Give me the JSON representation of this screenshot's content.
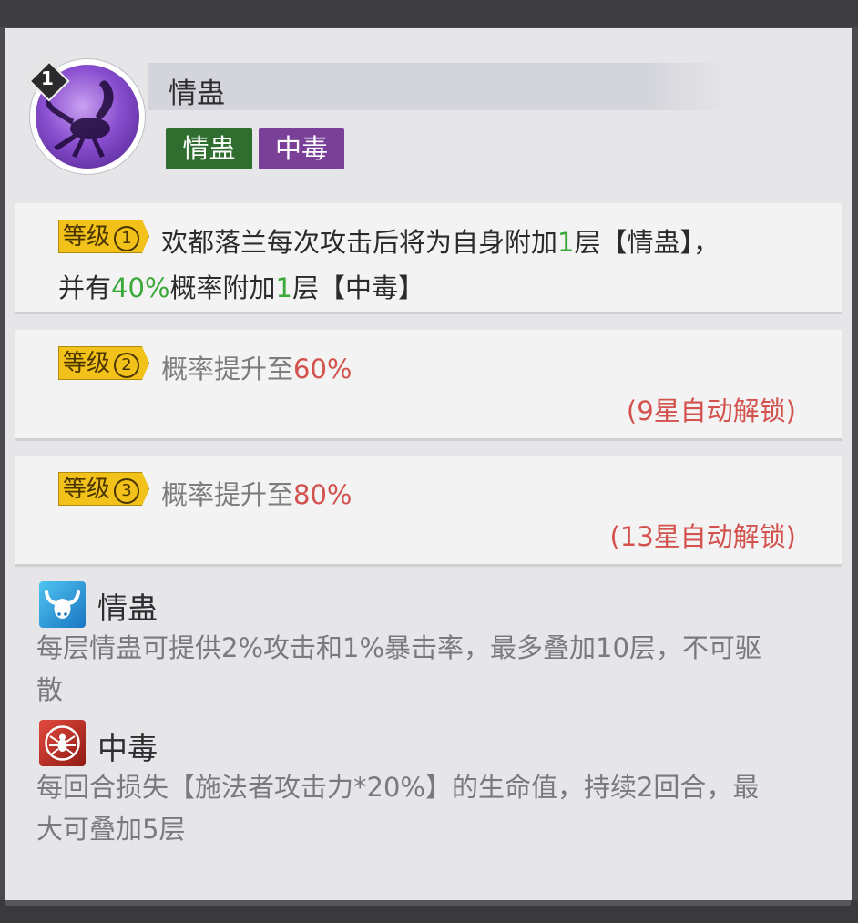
{
  "skill": {
    "level_indicator": "1",
    "name": "情蛊",
    "tags": [
      "情蛊",
      "中毒"
    ],
    "icon": "scorpion-icon"
  },
  "levels": [
    {
      "badge_text": "等级",
      "badge_num": "1",
      "line1": [
        "欢都落兰每次攻击后将为自身附加",
        "1",
        "层【情蛊】，"
      ],
      "line2": [
        "并有",
        "40%",
        "概率附加",
        "1",
        "层【中毒】"
      ]
    },
    {
      "badge_text": "等级",
      "badge_num": "2",
      "text": "概率提升至",
      "value": "60%",
      "unlock": "(9星自动解锁)"
    },
    {
      "badge_text": "等级",
      "badge_num": "3",
      "text": "概率提升至",
      "value": "80%",
      "unlock": "(13星自动解锁)"
    }
  ],
  "effects": [
    {
      "name": "情蛊",
      "icon": "bull-head-icon",
      "desc_line1": "每层情蛊可提供2%攻击和1%暴击率，最多叠加10层，不可驱",
      "desc_line2": "散"
    },
    {
      "name": "中毒",
      "icon": "spider-icon",
      "desc_line1": "每回合损失【施法者攻击力*20%】的生命值，持续2回合，最",
      "desc_line2": "大可叠加5层"
    }
  ],
  "colors": {
    "green_highlight": "#3aa93a",
    "red_highlight": "#d3524d",
    "badge_gold": "#f2c21a",
    "tag_green": "#2f6e2f",
    "tag_purple": "#7a3f97"
  }
}
